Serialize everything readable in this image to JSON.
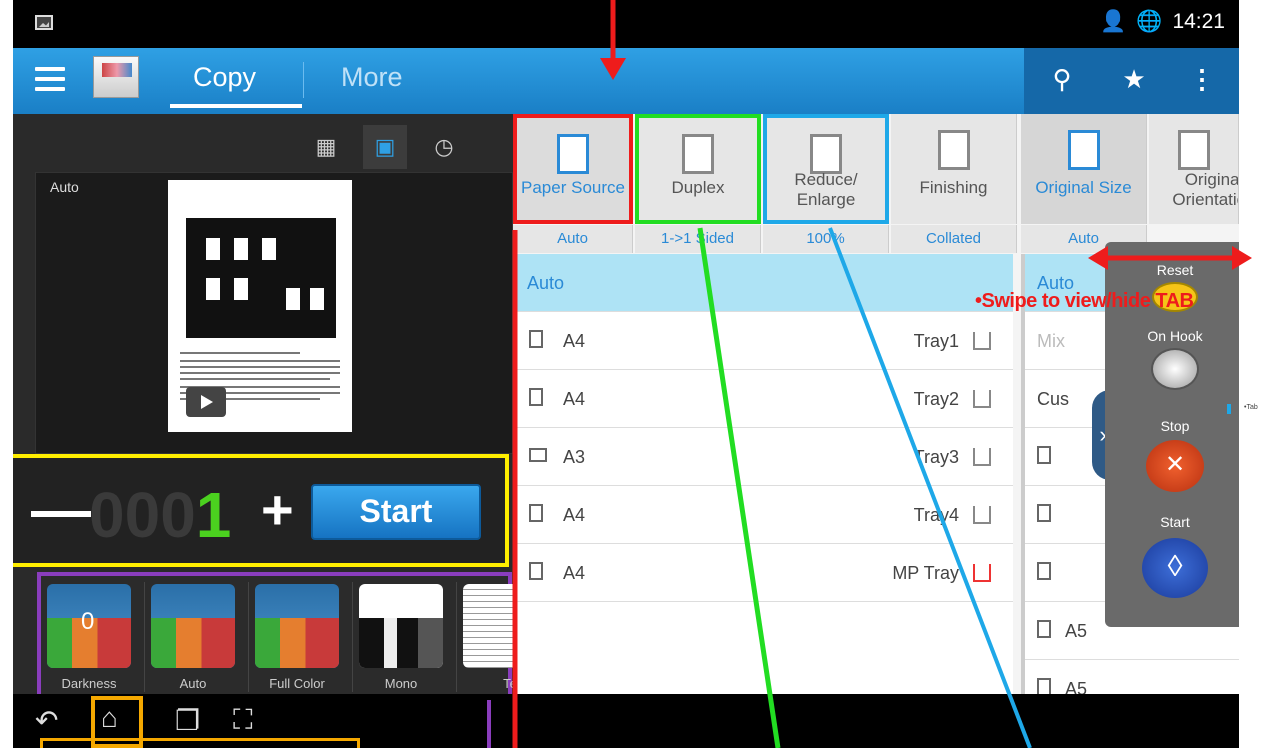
{
  "status_bar": {
    "time": "14:21"
  },
  "action_bar": {
    "tabs": [
      {
        "label": "Copy",
        "selected": true
      },
      {
        "label": "More",
        "selected": false
      }
    ],
    "icons": [
      "search-icon",
      "star-icon",
      "overflow-menu-icon"
    ]
  },
  "preview": {
    "label": "Auto"
  },
  "copies": {
    "dim_digits": "000",
    "lit_digit": "1",
    "start_label": "Start"
  },
  "color_modes": [
    {
      "label": "Darkness",
      "value": "0"
    },
    {
      "label": "Auto"
    },
    {
      "label": "Full Color"
    },
    {
      "label": "Mono",
      "selected": true
    },
    {
      "label": "Text"
    }
  ],
  "options": [
    {
      "label": "Paper Source",
      "value": "Auto"
    },
    {
      "label": "Duplex",
      "value": "1->1 Sided"
    },
    {
      "label": "Reduce/ Enlarge",
      "value": "100%"
    },
    {
      "label": "Finishing",
      "value": "Collated"
    },
    {
      "label": "Original Size",
      "value": "Auto"
    },
    {
      "label": "Original Orientation",
      "value": ""
    }
  ],
  "paper_source_list": [
    {
      "size": "Auto",
      "tray": "",
      "selected": true
    },
    {
      "size": "A4",
      "tray": "Tray1"
    },
    {
      "size": "A4",
      "tray": "Tray2"
    },
    {
      "size": "A3",
      "tray": "Tray3"
    },
    {
      "size": "A4",
      "tray": "Tray4"
    },
    {
      "size": "A4",
      "tray": "MP Tray"
    }
  ],
  "original_size_list": [
    "Auto",
    "Mix",
    "Cus",
    "",
    "",
    "",
    "A5",
    "A5"
  ],
  "side_panel": {
    "reset": "Reset",
    "on_hook": "On Hook",
    "stop": "Stop",
    "start": "Start"
  },
  "annotations": {
    "swipe_text": "•Swipe to view/hide TAB",
    "tab_side_label": "•Tab"
  },
  "colors": {
    "action_bar_blue": "#1a7fc6",
    "annotation_red": "#ee1c1c",
    "annotation_green": "#22dd22",
    "annotation_cyan": "#1ea8e8",
    "annotation_yellow": "#ffee00",
    "annotation_purple": "#8a3dbd",
    "annotation_orange": "#f5a800"
  }
}
